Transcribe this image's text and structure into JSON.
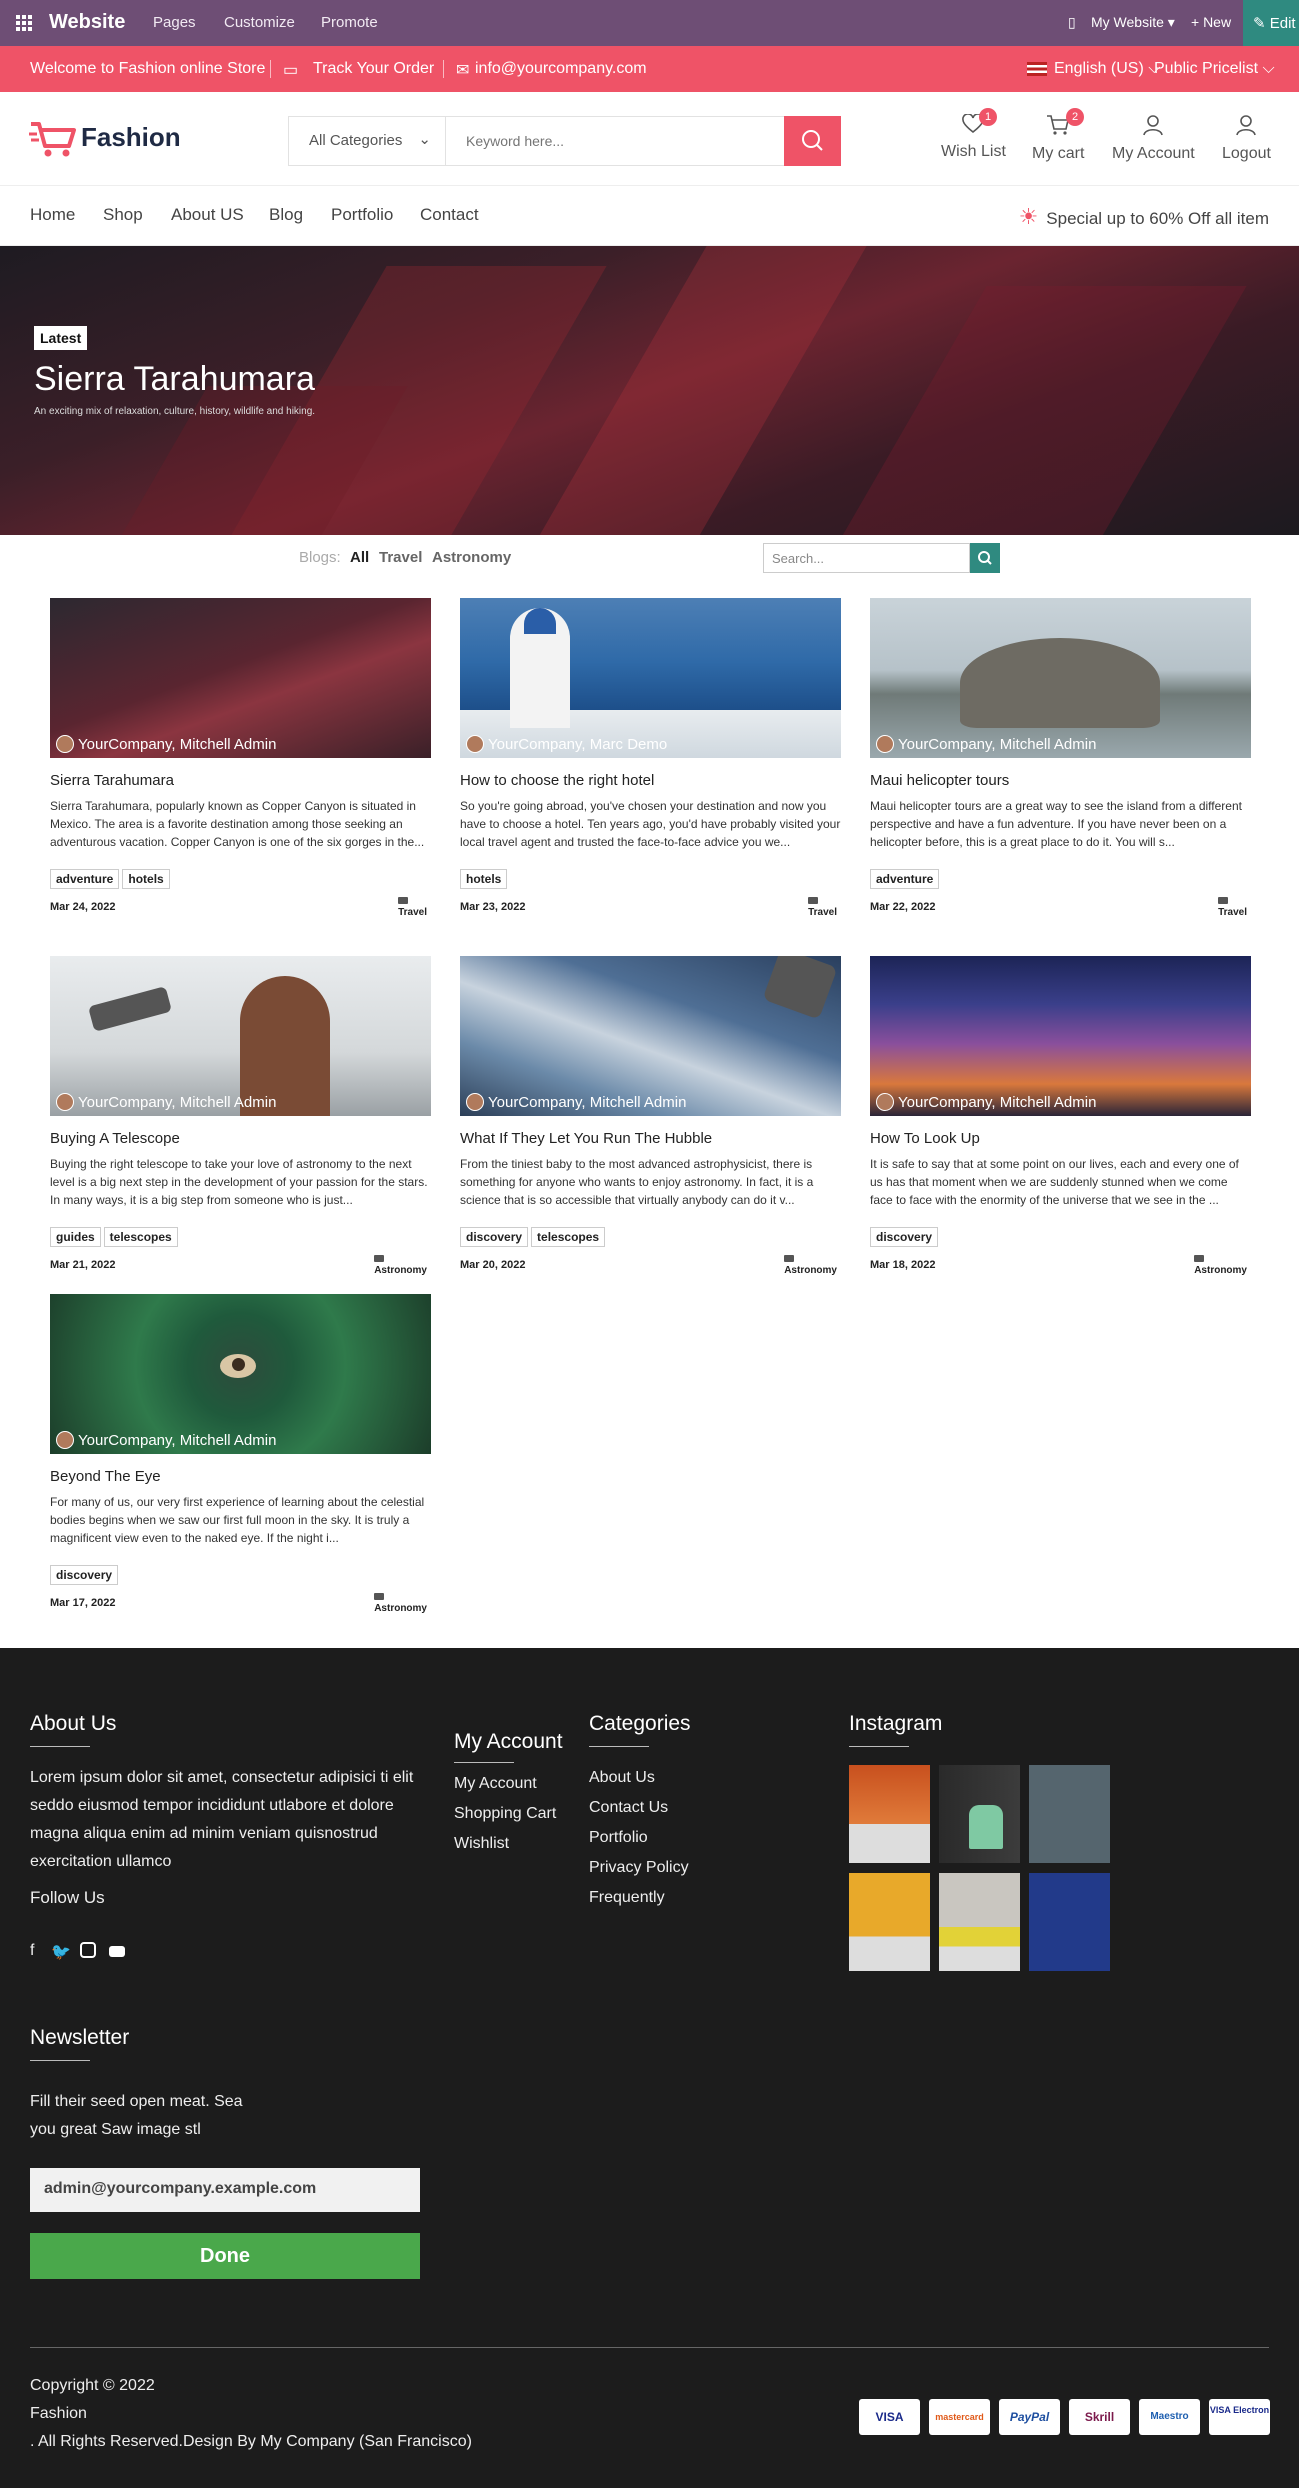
{
  "adminbar": {
    "brand": "Website",
    "menu": [
      "Pages",
      "Customize",
      "Promote"
    ],
    "my_website": "My Website ▾",
    "new": "+ New",
    "edit": "✎ Edit"
  },
  "promobar": {
    "welcome": "Welcome to Fashion online Store",
    "track": "Track Your Order",
    "email": "info@yourcompany.com",
    "language": "English (US) ⌵",
    "pricelist": "Public Pricelist ⌵"
  },
  "header": {
    "logo_text": "Fashion",
    "category": "All Categories",
    "search_placeholder": "Keyword here...",
    "wishlist_label": "Wish List",
    "wishlist_count": "1",
    "cart_label": "My cart",
    "cart_count": "2",
    "account_label": "My Account",
    "logout_label": "Logout"
  },
  "nav": {
    "links": [
      "Home",
      "Shop",
      "About US",
      "Blog",
      "Portfolio",
      "Contact"
    ],
    "special": "Special up to 60% Off all item"
  },
  "hero": {
    "tag": "Latest",
    "title": "Sierra Tarahumara",
    "subtitle": "An exciting mix of relaxation, culture, history, wildlife and hiking."
  },
  "filters": {
    "label": "Blogs:",
    "all": "All",
    "travel": "Travel",
    "astronomy": "Astronomy",
    "search_placeholder": "Search..."
  },
  "posts": [
    {
      "author": "YourCompany, Mitchell Admin",
      "title": "Sierra Tarahumara",
      "excerpt": "Sierra Tarahumara, popularly known as Copper Canyon is situated in Mexico. The area is a favorite destination among those seeking an adventurous vacation. Copper Canyon is one of the six gorges in the...",
      "tags": [
        "adventure",
        "hotels"
      ],
      "date": "Mar 24, 2022",
      "blog": "Travel"
    },
    {
      "author": "YourCompany, Marc Demo",
      "title": "How to choose the right hotel",
      "excerpt": "So you're going abroad, you've chosen your destination and now you have to choose a hotel. Ten years ago, you'd have probably visited your local travel agent and trusted the face-to-face advice you we...",
      "tags": [
        "hotels"
      ],
      "date": "Mar 23, 2022",
      "blog": "Travel"
    },
    {
      "author": "YourCompany, Mitchell Admin",
      "title": "Maui helicopter tours",
      "excerpt": "Maui helicopter tours are a great way to see the island from a different perspective and have a fun adventure. If you have never been on a helicopter before, this is a great place to do it. You will s...",
      "tags": [
        "adventure"
      ],
      "date": "Mar 22, 2022",
      "blog": "Travel"
    },
    {
      "author": "YourCompany, Mitchell Admin",
      "title": "Buying A Telescope",
      "excerpt": "Buying the right telescope to take your love of astronomy to the next level is a big next step in the development of your passion for the stars. In many ways, it is a big step from someone who is just...",
      "tags": [
        "guides",
        "telescopes"
      ],
      "date": "Mar 21, 2022",
      "blog": "Astronomy"
    },
    {
      "author": "YourCompany, Mitchell Admin",
      "title": "What If They Let You Run The Hubble",
      "excerpt": "From the tiniest baby to the most advanced astrophysicist, there is something for anyone who wants to enjoy astronomy. In fact, it is a science that is so accessible that virtually anybody can do it v...",
      "tags": [
        "discovery",
        "telescopes"
      ],
      "date": "Mar 20, 2022",
      "blog": "Astronomy"
    },
    {
      "author": "YourCompany, Mitchell Admin",
      "title": "How To Look Up",
      "excerpt": "It is safe to say that at some point on our lives, each and every one of us has that moment when we are suddenly stunned when we come face to face with the enormity of the universe that we see in the ...",
      "tags": [
        "discovery"
      ],
      "date": "Mar 18, 2022",
      "blog": "Astronomy"
    },
    {
      "author": "YourCompany, Mitchell Admin",
      "title": "Beyond The Eye",
      "excerpt": "For many of us, our very first experience of learning about the celestial bodies begins when we saw our first full moon in the sky. It is truly a magnificent view even to the naked eye. If the night i...",
      "tags": [
        "discovery"
      ],
      "date": "Mar 17, 2022",
      "blog": "Astronomy"
    }
  ],
  "footer": {
    "about_title": "About Us",
    "about_text": "Lorem ipsum dolor sit amet, consectetur adipisici ti elit seddo eiusmod tempor incididunt utlabore et dolore magna aliqua enim ad minim veniam quisnostrud exercitation ullamco",
    "follow_title": "Follow Us",
    "account_title": "My Account",
    "account_links": [
      "My Account",
      "Shopping Cart",
      "Wishlist"
    ],
    "categories_title": "Categories",
    "category_links": [
      "About Us",
      "Contact Us",
      "Portfolio",
      "Privacy Policy",
      "Frequently"
    ],
    "instagram_title": "Instagram",
    "newsletter_title": "Newsletter",
    "newsletter_text": "Fill their seed open meat. Sea you great Saw image stl",
    "email_value": "admin@yourcompany.example.com",
    "done_label": "Done",
    "copyright_1": "Copyright © 2022",
    "copyright_2": "Fashion",
    "copyright_3": ". All Rights Reserved.Design By My Company (San Francisco)",
    "payments": [
      "VISA",
      "mastercard",
      "PayPal",
      "Skrill",
      "Maestro",
      "VISA Electron"
    ]
  },
  "colors": {
    "accent": "#ef5367",
    "admin": "#6e4e75",
    "teal": "#2f8a80",
    "footer_bg": "#1c1c1c",
    "done": "#4aa84b"
  }
}
